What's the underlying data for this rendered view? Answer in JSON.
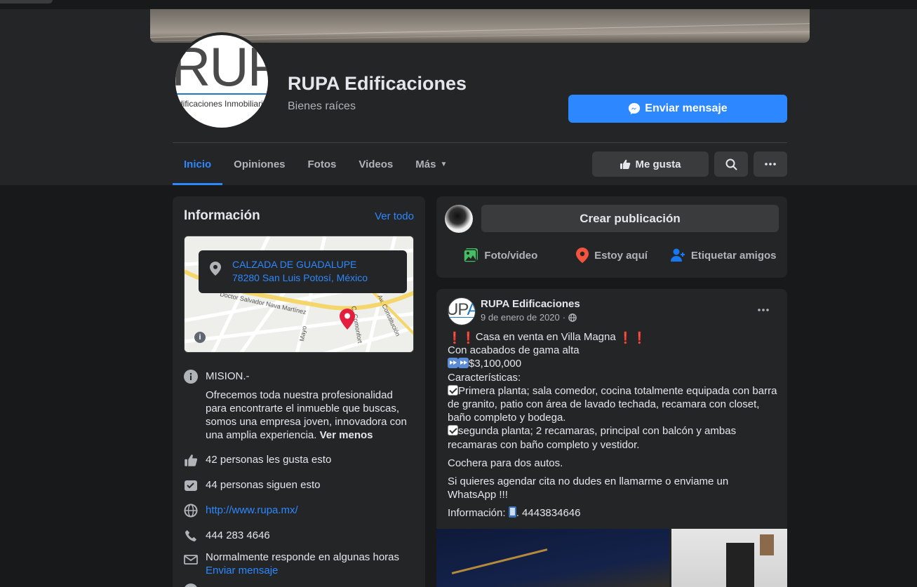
{
  "page": {
    "name": "RUPA Edificaciones",
    "category": "Bienes raíces",
    "send_message_label": "Enviar mensaje",
    "logo_text": "RUPA",
    "logo_subtitle": "Edificaciones Inmobiliarias"
  },
  "tabs": [
    {
      "label": "Inicio",
      "active": true
    },
    {
      "label": "Opiniones",
      "active": false
    },
    {
      "label": "Fotos",
      "active": false
    },
    {
      "label": "Videos",
      "active": false
    },
    {
      "label": "Más",
      "active": false
    }
  ],
  "actions": {
    "like_label": "Me gusta",
    "search_icon": "search-icon",
    "more_icon": "more-icon"
  },
  "info": {
    "title": "Información",
    "see_all": "Ver todo",
    "address_line1": "CALZADA DE GUADALUPE",
    "address_line2": "78280 San Luis Potosí, México",
    "map_streets": [
      "Doctor Salvador Nava Martínez",
      "Av. Constitución",
      "C. Comonfort",
      "Mayo"
    ],
    "mission_title": "MISION.-",
    "mission_text": "Ofrecemos toda nuestra profesionalidad para encontrarte el inmueble que buscas, somos una empresa joven, innovadora con una amplia experiencia.",
    "see_less": "Ver menos",
    "likes": "42 personas les gusta esto",
    "follows": "44 personas siguen esto",
    "website": "http://www.rupa.mx/",
    "phone": "444 283 4646",
    "response": "Normalmente responde en algunas horas",
    "response_link": "Enviar mensaje"
  },
  "composer": {
    "placeholder": "Crear publicación",
    "photo_video": "Foto/video",
    "check_in": "Estoy aquí",
    "tag_friends": "Etiquetar amigos"
  },
  "post": {
    "author": "RUPA Edificaciones",
    "date": "9 de enero de 2020",
    "date_separator": "·",
    "line1": "Casa en venta en Villa Magna",
    "line2": "Con acabados de gama alta",
    "price": "$3,100,000",
    "features_label": "Características:",
    "feature1": "Primera planta; sala comedor, cocina totalmente equipada con barra de granito, patio con área de lavado techada, recamara con closet, baño completo y bodega.",
    "feature2": "segunda planta; 2 recamaras, principal con balcón y ambas recamaras con baño completo y vestidor.",
    "garage": "Cochera para dos autos.",
    "cta": "Si quieres agendar cita no dudes en llamarme o enviame un WhatsApp !!!",
    "contact_label": "Información:",
    "contact_number": ". 4443834646"
  },
  "colors": {
    "accent": "#2d88ff",
    "background": "#18191a",
    "card": "#242526",
    "map_pin": "#e41e3f"
  }
}
